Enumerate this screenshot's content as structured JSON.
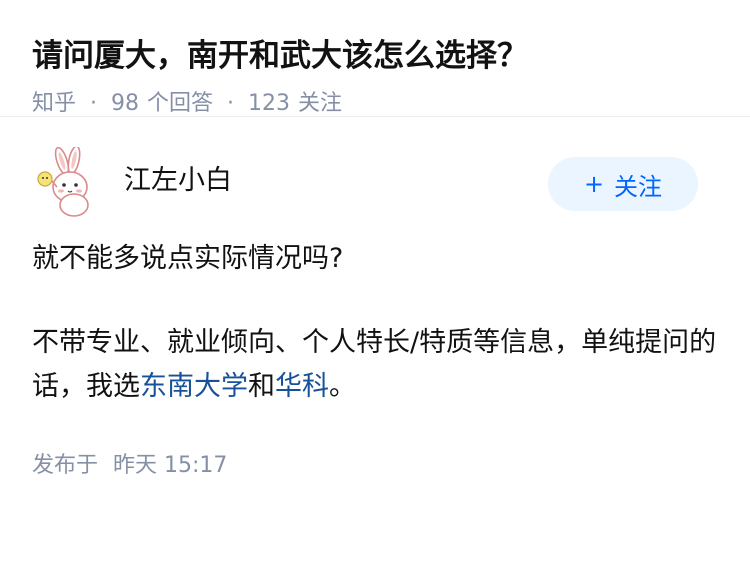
{
  "question": {
    "title": "请问厦大，南开和武大该怎么选择？",
    "source": "知乎",
    "answer_count": "98",
    "answer_label": "个回答",
    "follow_count": "123",
    "follow_label": "关注"
  },
  "answer": {
    "author": "江左小白",
    "follow_button": "关注",
    "follow_icon": "plus-icon",
    "paragraph1": "就不能多说点实际情况吗?",
    "paragraph2_part1": "不带专业、就业倾向、个人特长/特质等信息，单纯提问的话，我选",
    "link1": "东南大学",
    "paragraph2_conj": "和",
    "link2": "华科",
    "paragraph2_end": "。",
    "publish_label": "发布于",
    "publish_time": "昨天 15:17"
  },
  "colors": {
    "accent": "#0066ff",
    "link": "#175199",
    "meta_gray": "#8590a6",
    "button_bg": "#ebf5ff"
  }
}
